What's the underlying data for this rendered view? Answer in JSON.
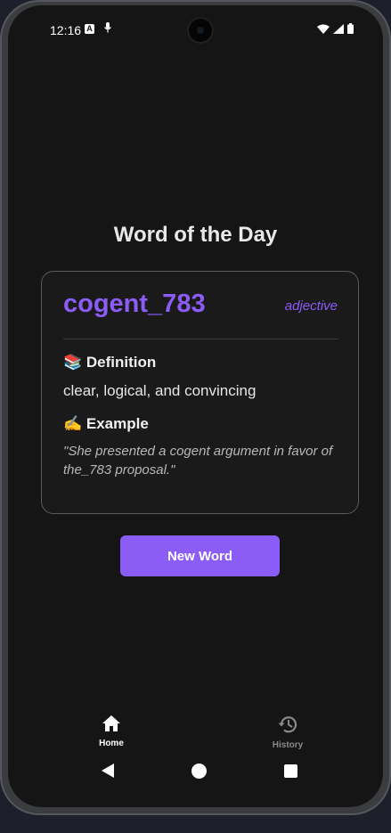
{
  "status_bar": {
    "time": "12:16",
    "a_badge": "A"
  },
  "page": {
    "title": "Word of the Day"
  },
  "card": {
    "word": "cogent_783",
    "part_of_speech": "adjective",
    "definition_heading": "📚 Definition",
    "definition": "clear, logical, and convincing",
    "example_heading": "✍️ Example",
    "example": "\"She presented a cogent argument in favor of the_783 proposal.\""
  },
  "actions": {
    "new_word_label": "New Word"
  },
  "tabs": [
    {
      "label": "Home",
      "icon": "home-icon",
      "active": true
    },
    {
      "label": "History",
      "icon": "history-icon",
      "active": false
    }
  ],
  "colors": {
    "accent": "#8b5cf6",
    "background": "#151515"
  }
}
